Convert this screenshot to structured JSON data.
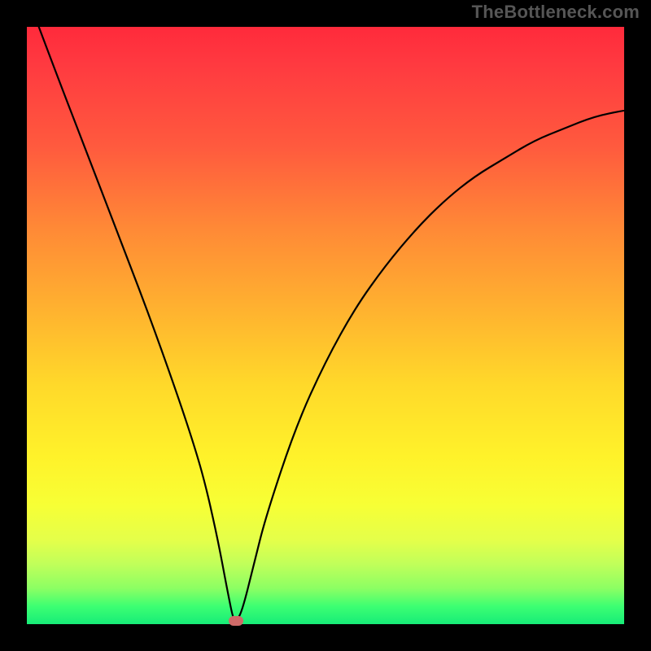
{
  "attribution": "TheBottleneck.com",
  "colors": {
    "frame": "#000000",
    "gradient_top": "#ff2a3b",
    "gradient_bottom": "#17ec78",
    "curve": "#000000",
    "marker": "#cf6a68",
    "attribution_text": "#565656"
  },
  "chart_data": {
    "type": "line",
    "title": "",
    "xlabel": "",
    "ylabel": "",
    "xlim": [
      0,
      100
    ],
    "ylim": [
      0,
      100
    ],
    "series": [
      {
        "name": "bottleneck-curve",
        "x": [
          2,
          5,
          10,
          15,
          20,
          25,
          28,
          30,
          32,
          33.5,
          34.5,
          35,
          36,
          38,
          40,
          45,
          50,
          55,
          60,
          65,
          70,
          75,
          80,
          85,
          90,
          95,
          100
        ],
        "y": [
          100,
          92,
          79,
          66,
          53,
          39,
          30,
          23,
          14,
          6,
          1,
          0.5,
          2,
          10,
          18,
          33,
          44,
          53,
          60,
          66,
          71,
          75,
          78,
          81,
          83,
          85,
          86
        ]
      }
    ],
    "marker": {
      "x": 35,
      "y": 0.5
    },
    "notes": "x and y are approximate percentages of the plot area width/height; y measured from bottom. Curve is a sharp V near x≈35 with left branch steep and right branch rising concavely."
  }
}
